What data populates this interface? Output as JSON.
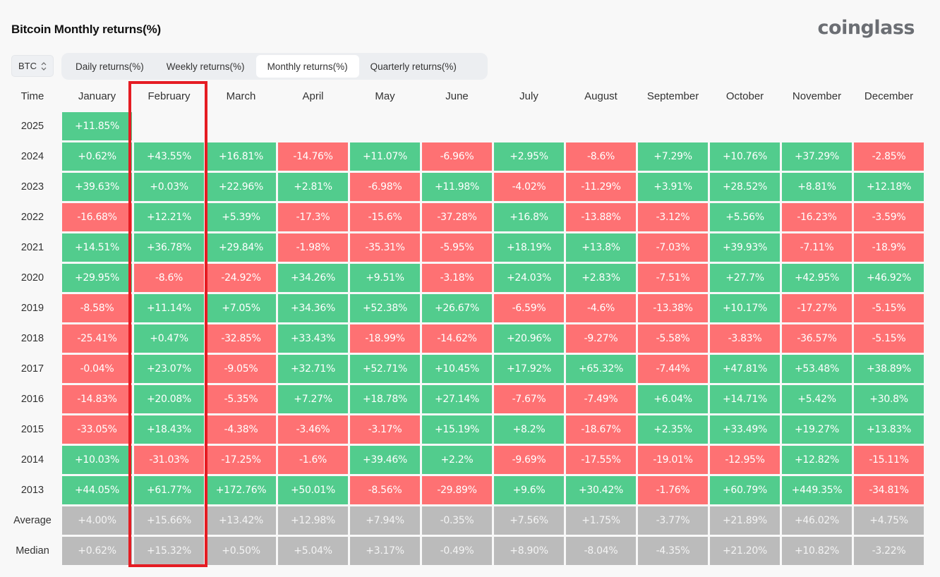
{
  "header": {
    "title": "Bitcoin Monthly returns(%)",
    "brand": "coinglass"
  },
  "controls": {
    "coin_select": {
      "value": "BTC",
      "icon": "chevron-up-down-icon"
    },
    "tabs": [
      {
        "label": "Daily returns(%)",
        "active": false
      },
      {
        "label": "Weekly returns(%)",
        "active": false
      },
      {
        "label": "Monthly returns(%)",
        "active": true
      },
      {
        "label": "Quarterly returns(%)",
        "active": false
      }
    ]
  },
  "highlight": {
    "column": "February",
    "color": "#e51c23"
  },
  "colors": {
    "positive": "#52cc8d",
    "negative": "#fe7173",
    "stat": "#bbbbbb"
  },
  "chart_data": {
    "type": "heatmap",
    "title": "Bitcoin Monthly returns(%)",
    "row_header": "Time",
    "columns": [
      "January",
      "February",
      "March",
      "April",
      "May",
      "June",
      "July",
      "August",
      "September",
      "October",
      "November",
      "December"
    ],
    "rows": [
      {
        "label": "2025",
        "values": [
          "+11.85%",
          null,
          null,
          null,
          null,
          null,
          null,
          null,
          null,
          null,
          null,
          null
        ]
      },
      {
        "label": "2024",
        "values": [
          "+0.62%",
          "+43.55%",
          "+16.81%",
          "-14.76%",
          "+11.07%",
          "-6.96%",
          "+2.95%",
          "-8.6%",
          "+7.29%",
          "+10.76%",
          "+37.29%",
          "-2.85%"
        ]
      },
      {
        "label": "2023",
        "values": [
          "+39.63%",
          "+0.03%",
          "+22.96%",
          "+2.81%",
          "-6.98%",
          "+11.98%",
          "-4.02%",
          "-11.29%",
          "+3.91%",
          "+28.52%",
          "+8.81%",
          "+12.18%"
        ]
      },
      {
        "label": "2022",
        "values": [
          "-16.68%",
          "+12.21%",
          "+5.39%",
          "-17.3%",
          "-15.6%",
          "-37.28%",
          "+16.8%",
          "-13.88%",
          "-3.12%",
          "+5.56%",
          "-16.23%",
          "-3.59%"
        ]
      },
      {
        "label": "2021",
        "values": [
          "+14.51%",
          "+36.78%",
          "+29.84%",
          "-1.98%",
          "-35.31%",
          "-5.95%",
          "+18.19%",
          "+13.8%",
          "-7.03%",
          "+39.93%",
          "-7.11%",
          "-18.9%"
        ]
      },
      {
        "label": "2020",
        "values": [
          "+29.95%",
          "-8.6%",
          "-24.92%",
          "+34.26%",
          "+9.51%",
          "-3.18%",
          "+24.03%",
          "+2.83%",
          "-7.51%",
          "+27.7%",
          "+42.95%",
          "+46.92%"
        ]
      },
      {
        "label": "2019",
        "values": [
          "-8.58%",
          "+11.14%",
          "+7.05%",
          "+34.36%",
          "+52.38%",
          "+26.67%",
          "-6.59%",
          "-4.6%",
          "-13.38%",
          "+10.17%",
          "-17.27%",
          "-5.15%"
        ]
      },
      {
        "label": "2018",
        "values": [
          "-25.41%",
          "+0.47%",
          "-32.85%",
          "+33.43%",
          "-18.99%",
          "-14.62%",
          "+20.96%",
          "-9.27%",
          "-5.58%",
          "-3.83%",
          "-36.57%",
          "-5.15%"
        ]
      },
      {
        "label": "2017",
        "values": [
          "-0.04%",
          "+23.07%",
          "-9.05%",
          "+32.71%",
          "+52.71%",
          "+10.45%",
          "+17.92%",
          "+65.32%",
          "-7.44%",
          "+47.81%",
          "+53.48%",
          "+38.89%"
        ]
      },
      {
        "label": "2016",
        "values": [
          "-14.83%",
          "+20.08%",
          "-5.35%",
          "+7.27%",
          "+18.78%",
          "+27.14%",
          "-7.67%",
          "-7.49%",
          "+6.04%",
          "+14.71%",
          "+5.42%",
          "+30.8%"
        ]
      },
      {
        "label": "2015",
        "values": [
          "-33.05%",
          "+18.43%",
          "-4.38%",
          "-3.46%",
          "-3.17%",
          "+15.19%",
          "+8.2%",
          "-18.67%",
          "+2.35%",
          "+33.49%",
          "+19.27%",
          "+13.83%"
        ]
      },
      {
        "label": "2014",
        "values": [
          "+10.03%",
          "-31.03%",
          "-17.25%",
          "-1.6%",
          "+39.46%",
          "+2.2%",
          "-9.69%",
          "-17.55%",
          "-19.01%",
          "-12.95%",
          "+12.82%",
          "-15.11%"
        ]
      },
      {
        "label": "2013",
        "values": [
          "+44.05%",
          "+61.77%",
          "+172.76%",
          "+50.01%",
          "-8.56%",
          "-29.89%",
          "+9.6%",
          "+30.42%",
          "-1.76%",
          "+60.79%",
          "+449.35%",
          "-34.81%"
        ]
      }
    ],
    "summary_rows": [
      {
        "label": "Average",
        "values": [
          "+4.00%",
          "+15.66%",
          "+13.42%",
          "+12.98%",
          "+7.94%",
          "-0.35%",
          "+7.56%",
          "+1.75%",
          "-3.77%",
          "+21.89%",
          "+46.02%",
          "+4.75%"
        ]
      },
      {
        "label": "Median",
        "values": [
          "+0.62%",
          "+15.32%",
          "+0.50%",
          "+5.04%",
          "+3.17%",
          "-0.49%",
          "+8.90%",
          "-8.04%",
          "-4.35%",
          "+21.20%",
          "+10.82%",
          "-3.22%"
        ]
      }
    ]
  }
}
